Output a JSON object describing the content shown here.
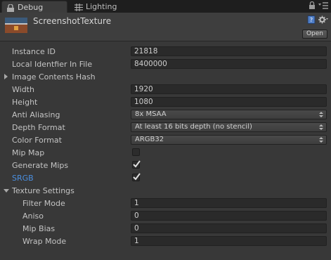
{
  "tabs": [
    {
      "label": "Debug",
      "icon": "lock-icon",
      "active": true
    },
    {
      "label": "Lighting",
      "icon": "lighting-grid-icon",
      "active": false
    }
  ],
  "window_controls": {
    "icons": [
      "lock-icon",
      "context-menu-icon"
    ]
  },
  "header": {
    "title": "ScreenshotTexture",
    "open_label": "Open",
    "icons": [
      "help-book-icon",
      "gear-icon"
    ]
  },
  "properties": [
    {
      "label": "Instance ID",
      "value": "21818",
      "kind": "field"
    },
    {
      "label": "Local Identfier In File",
      "value": "8400000",
      "kind": "field"
    },
    {
      "label": "Image Contents Hash",
      "kind": "foldout",
      "expanded": false
    },
    {
      "label": "Width",
      "value": "1920",
      "kind": "field"
    },
    {
      "label": "Height",
      "value": "1080",
      "kind": "field"
    },
    {
      "label": "Anti Aliasing",
      "value": "8x MSAA",
      "kind": "dropdown"
    },
    {
      "label": "Depth Format",
      "value": "At least 16 bits depth (no stencil)",
      "kind": "dropdown"
    },
    {
      "label": "Color Format",
      "value": "ARGB32",
      "kind": "dropdown"
    },
    {
      "label": "Mip Map",
      "checked": false,
      "kind": "checkbox"
    },
    {
      "label": "Generate Mips",
      "checked": true,
      "kind": "checkbox"
    },
    {
      "label": "SRGB",
      "checked": true,
      "kind": "checkbox",
      "highlight": "#4a8fe0"
    },
    {
      "label": "Texture Settings",
      "kind": "foldout",
      "expanded": true
    },
    {
      "label": "Filter Mode",
      "value": "1",
      "kind": "field",
      "indent": true
    },
    {
      "label": "Aniso",
      "value": "0",
      "kind": "field",
      "indent": true
    },
    {
      "label": "Mip Bias",
      "value": "0",
      "kind": "field",
      "indent": true
    },
    {
      "label": "Wrap Mode",
      "value": "1",
      "kind": "field",
      "indent": true
    }
  ],
  "colors": {
    "background": "#383838",
    "modified_label": "#4a8fe0"
  }
}
